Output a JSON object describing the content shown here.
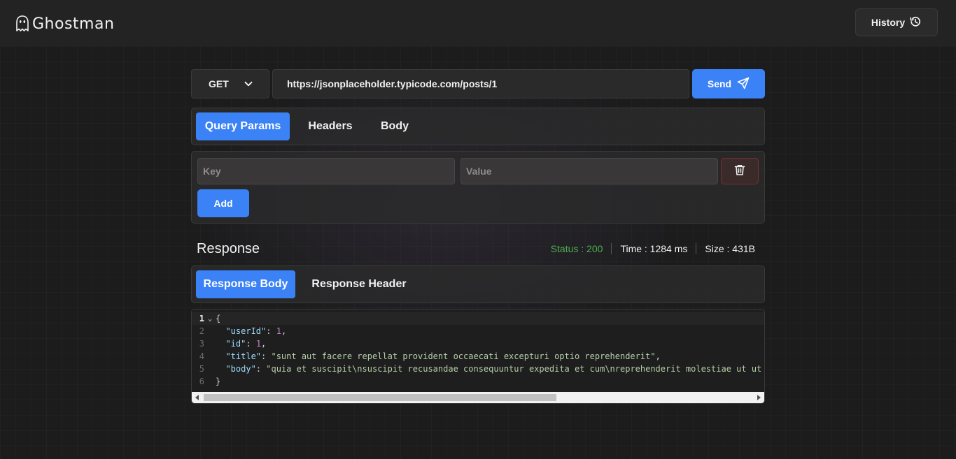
{
  "header": {
    "brand": "Ghostman",
    "history_label": "History"
  },
  "request": {
    "method": "GET",
    "url": "https://jsonplaceholder.typicode.com/posts/1",
    "send_label": "Send"
  },
  "request_tabs": [
    "Query Params",
    "Headers",
    "Body"
  ],
  "params": {
    "key_placeholder": "Key",
    "value_placeholder": "Value",
    "add_label": "Add"
  },
  "response": {
    "title": "Response",
    "status": "Status : 200",
    "time": "Time : 1284 ms",
    "size": "Size : 431B",
    "tabs": [
      "Response Body",
      "Response Header"
    ],
    "line_numbers": [
      "1",
      "2",
      "3",
      "4",
      "5",
      "6"
    ],
    "body_lines": [
      "{",
      "  \"userId\": 1,",
      "  \"id\": 1,",
      "  \"title\": \"sunt aut facere repellat provident occaecati excepturi optio reprehenderit\",",
      "  \"body\": \"quia et suscipit\\nsuscipit recusandae consequuntur expedita et cum\\nreprehenderit molestiae ut ut quas totam\\nnostrum rerum est autem sunt rem eveniet architecto\"",
      "}"
    ]
  },
  "colors": {
    "accent": "#3b82f6",
    "status_ok": "#4caf50",
    "danger": "#7a2f30"
  }
}
